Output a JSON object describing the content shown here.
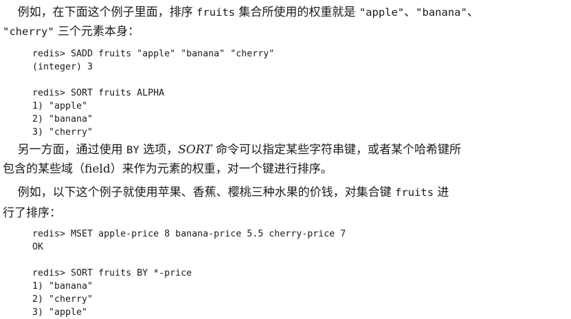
{
  "para1": {
    "line1_a": "    例如，在下面这个例子里面，排序 ",
    "line1_b": "fruits",
    "line1_c": " 集合所使用的权重就是 ",
    "line1_d": "\"apple\"",
    "line1_e": "、",
    "line1_f": "\"banana\"",
    "line1_g": "、",
    "line2_a": "\"cherry\"",
    "line2_b": " 三个元素本身："
  },
  "code1": {
    "lines": [
      "redis> SADD fruits \"apple\" \"banana\" \"cherry\"",
      "(integer) 3",
      "",
      "redis> SORT fruits ALPHA",
      "1) \"apple\"",
      "2) \"banana\"",
      "3) \"cherry\""
    ]
  },
  "para2": {
    "line1_a": "    另一方面，通过使用 ",
    "line1_b": "BY",
    "line1_c": " 选项，",
    "line1_d": "SORT",
    "line1_e": " 命令可以指定某些字符串键，或者某个哈希键所",
    "line2": "包含的某些域（field）来作为元素的权重，对一个键进行排序。"
  },
  "para3": {
    "line1_a": "    例如，以下这个例子就使用苹果、香蕉、樱桃三种水果的价钱，对集合键 ",
    "line1_b": "fruits",
    "line1_c": " 进",
    "line2": "行了排序："
  },
  "code2": {
    "lines": [
      "redis> MSET apple-price 8 banana-price 5.5 cherry-price 7",
      "OK",
      "",
      "redis> SORT fruits BY *-price",
      "1) \"banana\"",
      "2) \"cherry\"",
      "3) \"apple\""
    ]
  }
}
